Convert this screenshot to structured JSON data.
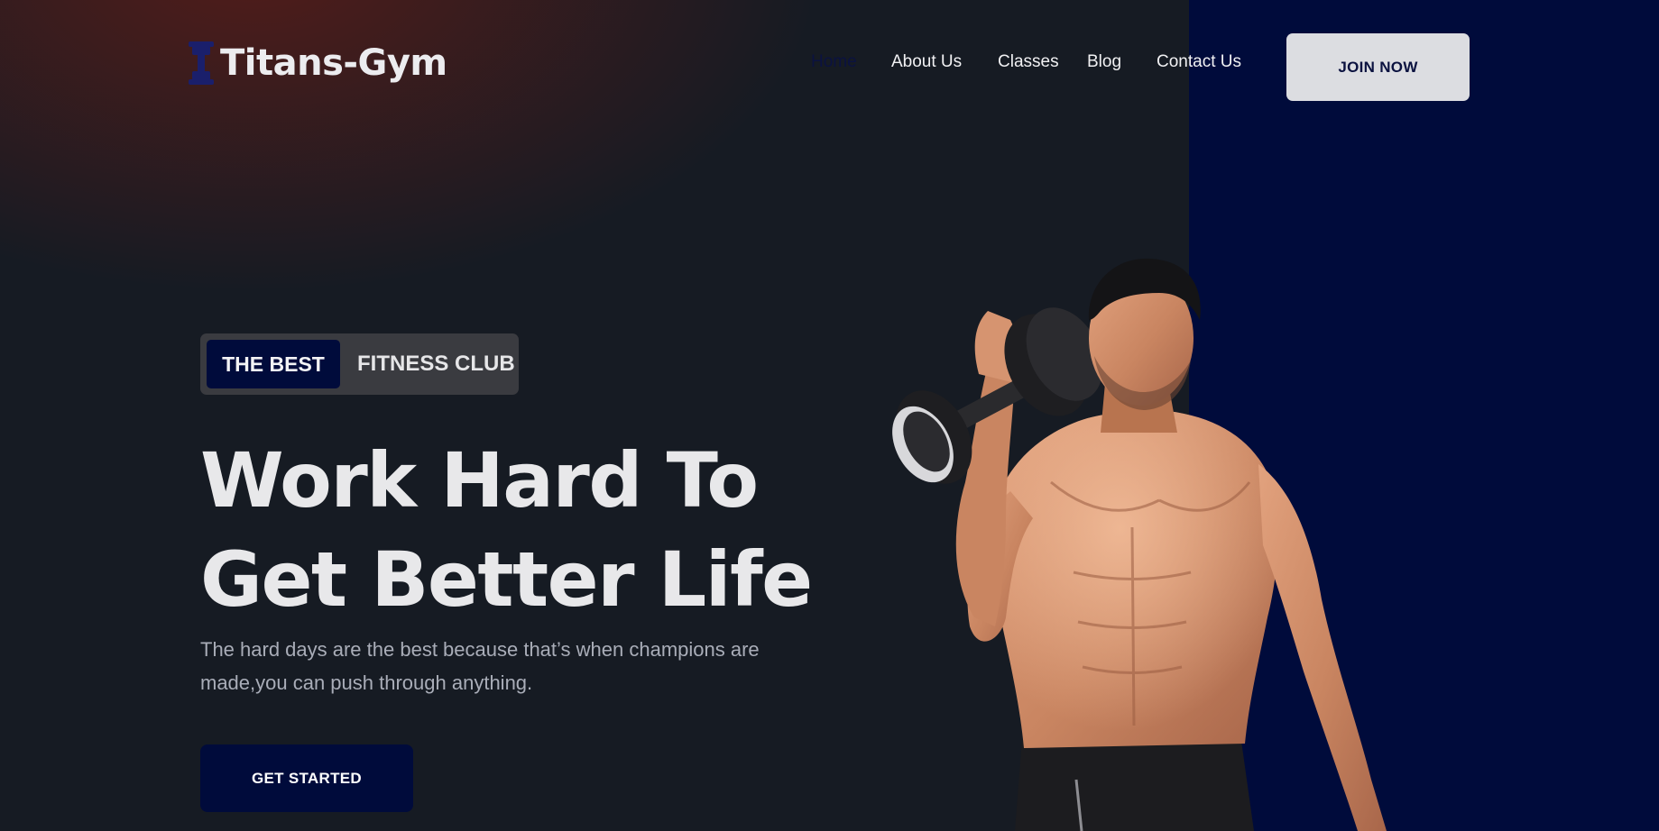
{
  "header": {
    "logo_text": "Titans-Gym",
    "logo_icon": "dumbbell-icon",
    "nav": [
      {
        "label": "Home",
        "active": true
      },
      {
        "label": "About Us",
        "active": false
      },
      {
        "label": "Classes",
        "active": false
      },
      {
        "label": "Blog",
        "active": false
      },
      {
        "label": "Contact Us",
        "active": false
      }
    ],
    "join_label": "JOIN NOW"
  },
  "hero": {
    "badge_highlight": "THE BEST",
    "badge_rest": "FITNESS CLUB",
    "headline_line1": "Work Hard To",
    "headline_line2": "Get Better Life",
    "subtext": "The hard days are the best because that’s when champions are made,you can push through anything.",
    "cta_label": "GET STARTED"
  },
  "colors": {
    "brand_navy": "#000b3b",
    "light_button": "#dcdde1",
    "dark_background": "#161b23",
    "accent_glow": "#5c1c18"
  }
}
